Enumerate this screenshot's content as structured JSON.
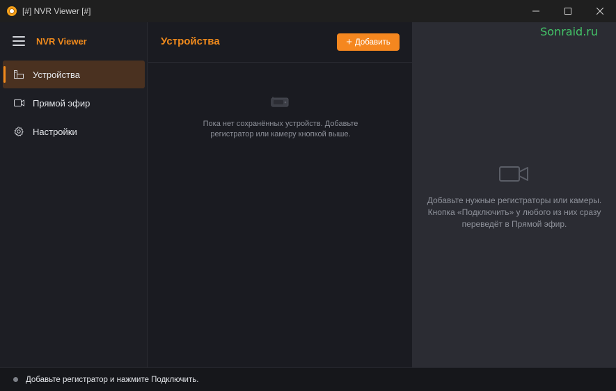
{
  "window": {
    "title": "[#] NVR Viewer [#]",
    "controls": [
      "minimize-icon",
      "maximize-icon",
      "close-icon"
    ]
  },
  "sidebar": {
    "brand": "NVR Viewer",
    "menu_icon": "hamburger-icon",
    "items": [
      {
        "label": "Устройства",
        "icon": "devices-icon",
        "active": true
      },
      {
        "label": "Прямой эфир",
        "icon": "camera-icon",
        "active": false
      },
      {
        "label": "Настройки",
        "icon": "gear-icon",
        "active": false
      }
    ]
  },
  "devices": {
    "title": "Устройства",
    "add_button": "Добавить",
    "add_icon": "plus-icon",
    "empty_icon": "recorder-icon",
    "empty_line1": "Пока нет сохранённых устройств. Добавьте",
    "empty_line2": "регистратор или камеру кнопкой выше."
  },
  "preview": {
    "watermark": "Sonraid.ru",
    "icon": "camera-icon",
    "line1": "Добавьте нужные регистраторы или камеры.",
    "line2": "Кнопка «Подключить» у любого из них сразу",
    "line3": "переведёт в Прямой эфир."
  },
  "status": {
    "text": "Добавьте регистратор и нажмите Подключить."
  },
  "colors": {
    "accent": "#f08a1c",
    "button": "#f5871f",
    "active_nav": "#4a3120",
    "watermark": "#43c468"
  }
}
